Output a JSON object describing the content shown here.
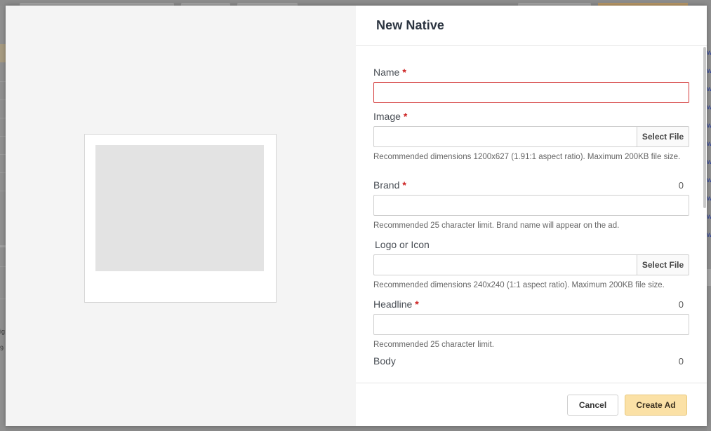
{
  "background": {
    "left_snippets": [
      "ig",
      "9"
    ]
  },
  "modal": {
    "title": "New Native",
    "fields": {
      "name": {
        "label": "Name",
        "required_marker": "*",
        "value": ""
      },
      "image": {
        "label": "Image",
        "required_marker": "*",
        "value": "",
        "button_label": "Select File",
        "help": "Recommended dimensions 1200x627 (1.91:1 aspect ratio). Maximum 200KB file size."
      },
      "brand": {
        "label": "Brand",
        "required_marker": "*",
        "value": "",
        "counter": "0",
        "help": "Recommended 25 character limit. Brand name will appear on the ad."
      },
      "logo": {
        "label": "Logo or Icon",
        "value": "",
        "button_label": "Select File",
        "help": "Recommended dimensions 240x240 (1:1 aspect ratio). Maximum 200KB file size."
      },
      "headline": {
        "label": "Headline",
        "required_marker": "*",
        "value": "",
        "counter": "0",
        "help": "Recommended 25 character limit."
      },
      "body": {
        "label": "Body",
        "counter": "0"
      }
    },
    "footer": {
      "cancel_label": "Cancel",
      "create_label": "Create Ad"
    }
  },
  "colors": {
    "required": "#cc1f1f",
    "error_border": "#d33a3a",
    "primary_button": "#fbe1a6"
  }
}
